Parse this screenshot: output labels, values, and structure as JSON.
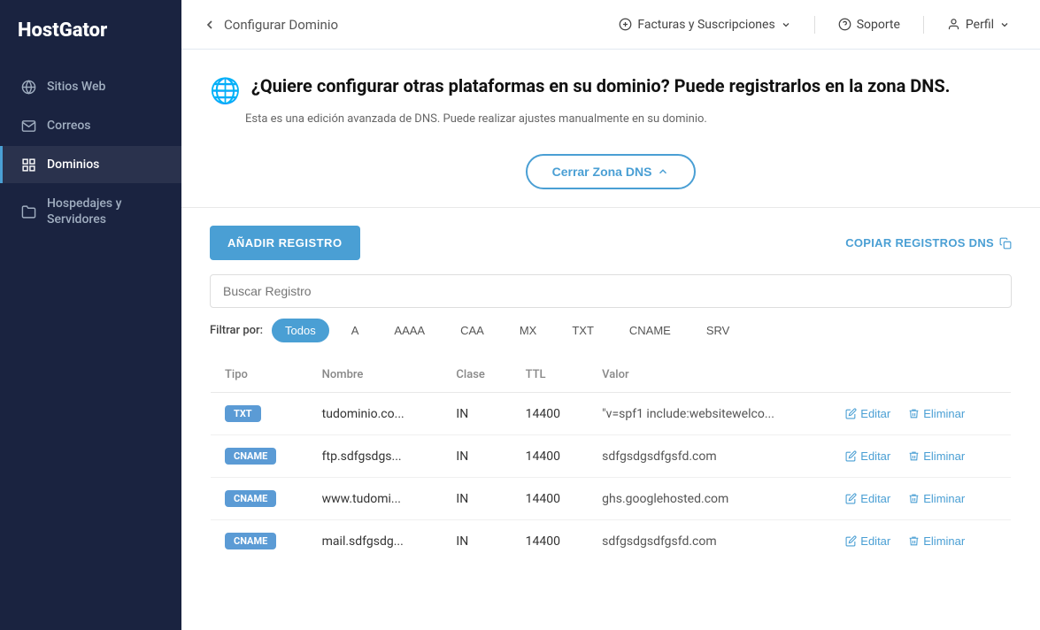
{
  "sidebar": {
    "logo": {
      "text": "HostGator"
    },
    "items": [
      {
        "id": "sitios-web",
        "label": "Sitios Web",
        "icon": "globe",
        "active": false
      },
      {
        "id": "correos",
        "label": "Correos",
        "icon": "email",
        "active": false
      },
      {
        "id": "dominios",
        "label": "Dominios",
        "icon": "grid",
        "active": true
      },
      {
        "id": "hospedajes",
        "label": "Hospedajes y Servidores",
        "icon": "folder",
        "active": false
      }
    ]
  },
  "topbar": {
    "back_label": "Configurar Dominio",
    "billing_label": "Facturas y Suscripciones",
    "support_label": "Soporte",
    "profile_label": "Perfil"
  },
  "dns_banner": {
    "title": "¿Quiere configurar otras plataformas en su dominio? Puede registrarlos en la zona DNS.",
    "subtitle": "Esta es una edición avanzada de DNS. Puede realizar ajustes manualmente en su dominio.",
    "close_btn": "Cerrar Zona DNS"
  },
  "records_section": {
    "add_btn": "AÑADIR REGISTRO",
    "copy_btn": "COPIAR REGISTROS DNS",
    "search_placeholder": "Buscar Registro",
    "filter_label": "Filtrar por:",
    "filters": [
      {
        "id": "todos",
        "label": "Todos",
        "active": true
      },
      {
        "id": "a",
        "label": "A",
        "active": false
      },
      {
        "id": "aaaa",
        "label": "AAAA",
        "active": false
      },
      {
        "id": "caa",
        "label": "CAA",
        "active": false
      },
      {
        "id": "mx",
        "label": "MX",
        "active": false
      },
      {
        "id": "txt",
        "label": "TXT",
        "active": false
      },
      {
        "id": "cname",
        "label": "CNAME",
        "active": false
      },
      {
        "id": "srv",
        "label": "SRV",
        "active": false
      }
    ],
    "table": {
      "headers": [
        "Tipo",
        "Nombre",
        "Clase",
        "TTL",
        "Valor"
      ],
      "rows": [
        {
          "type": "TXT",
          "type_class": "badge-txt",
          "name": "tudominio.co...",
          "clase": "IN",
          "ttl": "14400",
          "valor": "\"v=spf1 include:websitewelco...",
          "edit_label": "Editar",
          "delete_label": "Eliminar"
        },
        {
          "type": "CNAME",
          "type_class": "badge-cname",
          "name": "ftp.sdfgsdgs...",
          "clase": "IN",
          "ttl": "14400",
          "valor": "sdfgsdgsdfgsfd.com",
          "edit_label": "Editar",
          "delete_label": "Eliminar"
        },
        {
          "type": "CNAME",
          "type_class": "badge-cname",
          "name": "www.tudomi...",
          "clase": "IN",
          "ttl": "14400",
          "valor": "ghs.googlehosted.com",
          "edit_label": "Editar",
          "delete_label": "Eliminar"
        },
        {
          "type": "CNAME",
          "type_class": "badge-cname",
          "name": "mail.sdfgsdg...",
          "clase": "IN",
          "ttl": "14400",
          "valor": "sdfgsdgsdfgsfd.com",
          "edit_label": "Editar",
          "delete_label": "Eliminar"
        }
      ]
    }
  }
}
